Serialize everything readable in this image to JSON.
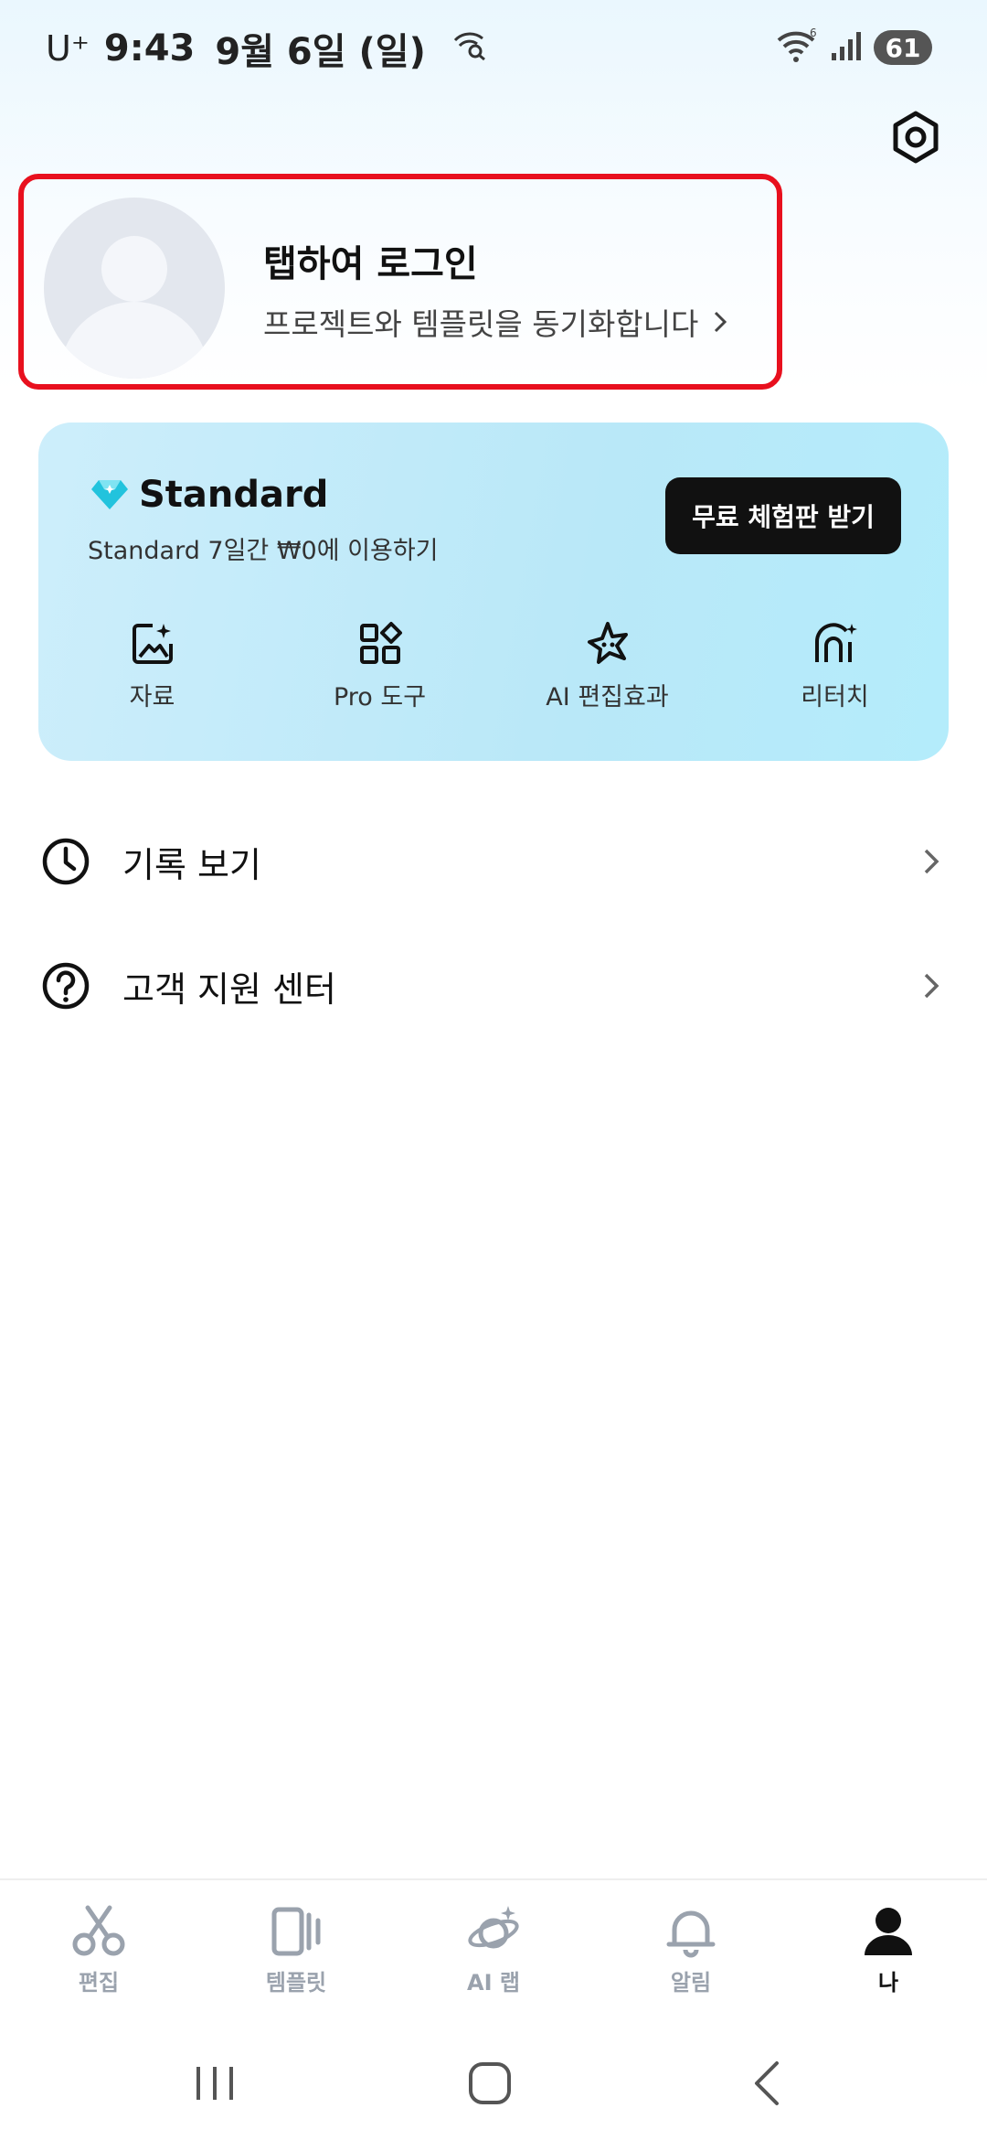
{
  "status_bar": {
    "carrier": "U⁺",
    "time": "9:43",
    "date": "9월 6일 (일)",
    "battery": "61"
  },
  "settings": {
    "icon": "gear-icon"
  },
  "login": {
    "title": "탭하여 로그인",
    "subtitle": "프로젝트와 템플릿을 동기화합니다"
  },
  "standard": {
    "title": "Standard",
    "subtitle": "Standard 7일간 ₩0에 이용하기",
    "trial_button": "무료 체험판 받기",
    "features": [
      {
        "label": "자료",
        "icon": "image-sparkle-icon"
      },
      {
        "label": "Pro 도구",
        "icon": "grid-shapes-icon"
      },
      {
        "label": "AI 편집효과",
        "icon": "ai-effect-icon"
      },
      {
        "label": "리터치",
        "icon": "retouch-icon"
      }
    ]
  },
  "menu": [
    {
      "label": "기록 보기",
      "icon": "clock-icon"
    },
    {
      "label": "고객 지원 센터",
      "icon": "question-icon"
    }
  ],
  "bottom_nav": [
    {
      "label": "편집",
      "icon": "scissors-icon"
    },
    {
      "label": "템플릿",
      "icon": "template-icon"
    },
    {
      "label": "AI 랩",
      "icon": "ai-lab-icon"
    },
    {
      "label": "알림",
      "icon": "bell-icon"
    },
    {
      "label": "나",
      "icon": "person-icon",
      "active": true
    }
  ],
  "colors": {
    "highlight_border": "#e8101e",
    "card_bg": "#b9e8f8",
    "diamond": "#22c3dd",
    "active_nav": "#111111",
    "inactive_nav": "#9aa2ad"
  }
}
